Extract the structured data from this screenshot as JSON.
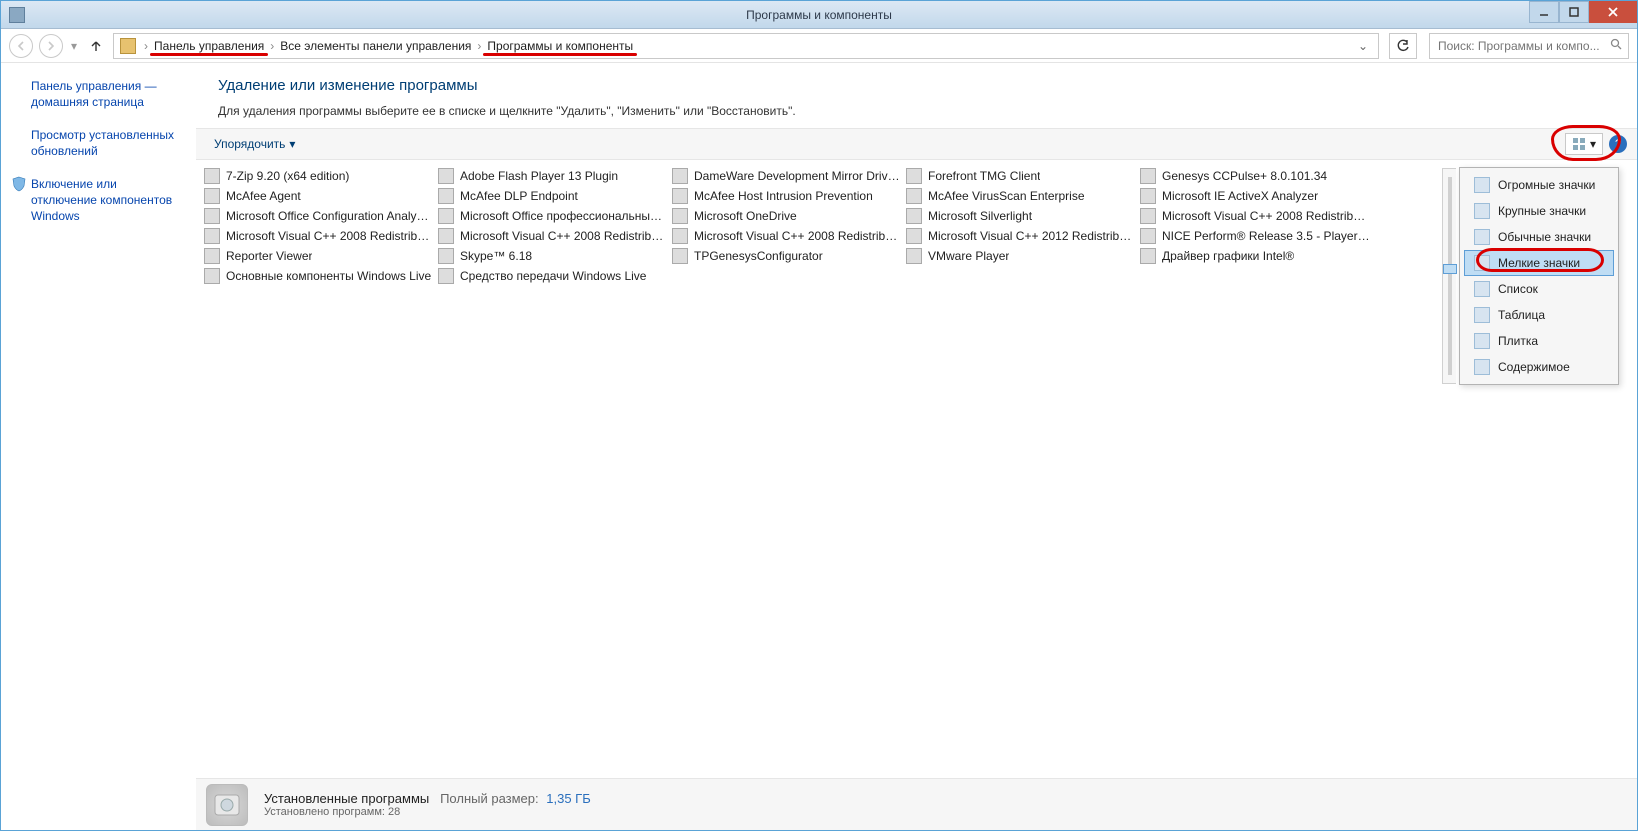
{
  "window": {
    "title": "Программы и компоненты"
  },
  "breadcrumbs": {
    "items": [
      "Панель управления",
      "Все элементы панели управления",
      "Программы и компоненты"
    ]
  },
  "search": {
    "placeholder": "Поиск: Программы и компо..."
  },
  "sidebar": {
    "items": [
      {
        "label": "Панель управления — домашняя страница"
      },
      {
        "label": "Просмотр установленных обновлений"
      },
      {
        "label": "Включение или отключение компонентов Windows"
      }
    ]
  },
  "content": {
    "heading": "Удаление или изменение программы",
    "subtext": "Для удаления программы выберите ее в списке и щелкните \"Удалить\", \"Изменить\" или \"Восстановить\"."
  },
  "toolbar": {
    "organize": "Упорядочить"
  },
  "view_menu": {
    "items": [
      "Огромные значки",
      "Крупные значки",
      "Обычные значки",
      "Мелкие значки",
      "Список",
      "Таблица",
      "Плитка",
      "Содержимое"
    ],
    "selected_index": 3
  },
  "programs": [
    "7-Zip 9.20 (x64 edition)",
    "Adobe Flash Player 13 Plugin",
    "DameWare Development Mirror Driver ...",
    "Forefront TMG Client",
    "Genesys CCPulse+ 8.0.101.34",
    "McAfee Agent",
    "McAfee DLP Endpoint",
    "McAfee Host Intrusion Prevention",
    "McAfee VirusScan Enterprise",
    "Microsoft IE ActiveX Analyzer",
    "Microsoft Office Configuration Analyze...",
    "Microsoft Office профессиональный п...",
    "Microsoft OneDrive",
    "Microsoft Silverlight",
    "Microsoft Visual C++ 2008 Redistributa...",
    "Microsoft Visual C++ 2008 Redistributa...",
    "Microsoft Visual C++ 2008 Redistributa...",
    "Microsoft Visual C++ 2008 Redistributa...",
    "Microsoft Visual C++ 2012 Redistributa...",
    "NICE Perform® Release 3.5 - Player Co...",
    "Reporter Viewer",
    "Skype™ 6.18",
    "TPGenesysConfigurator",
    "VMware Player",
    "Драйвер графики Intel®",
    "Основные компоненты Windows Live",
    "Средство передачи Windows Live"
  ],
  "status": {
    "title": "Установленные программы",
    "size_label": "Полный размер:",
    "size_value": "1,35 ГБ",
    "count_line": "Установлено программ: 28"
  }
}
